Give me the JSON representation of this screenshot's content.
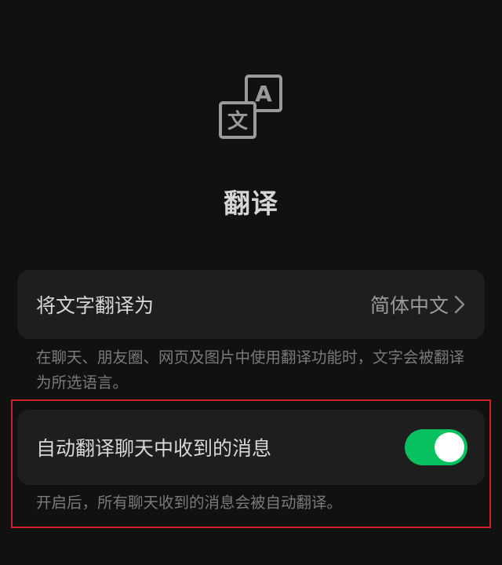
{
  "page": {
    "title": "翻译"
  },
  "translate_target": {
    "label": "将文字翻译为",
    "value": "简体中文",
    "description": "在聊天、朋友圈、网页及图片中使用翻译功能时，文字会被翻译为所选语言。"
  },
  "auto_translate": {
    "label": "自动翻译聊天中收到的消息",
    "enabled": true,
    "description": "开启后，所有聊天收到的消息会被自动翻译。"
  },
  "icons": {
    "header": "translate-icon",
    "header_glyph_a": "A",
    "header_glyph_b": "文",
    "row": "chevron-right-icon"
  },
  "colors": {
    "background": "#111111",
    "card": "#1e1e1e",
    "toggle_on": "#07c160",
    "highlight": "#d0222a"
  }
}
